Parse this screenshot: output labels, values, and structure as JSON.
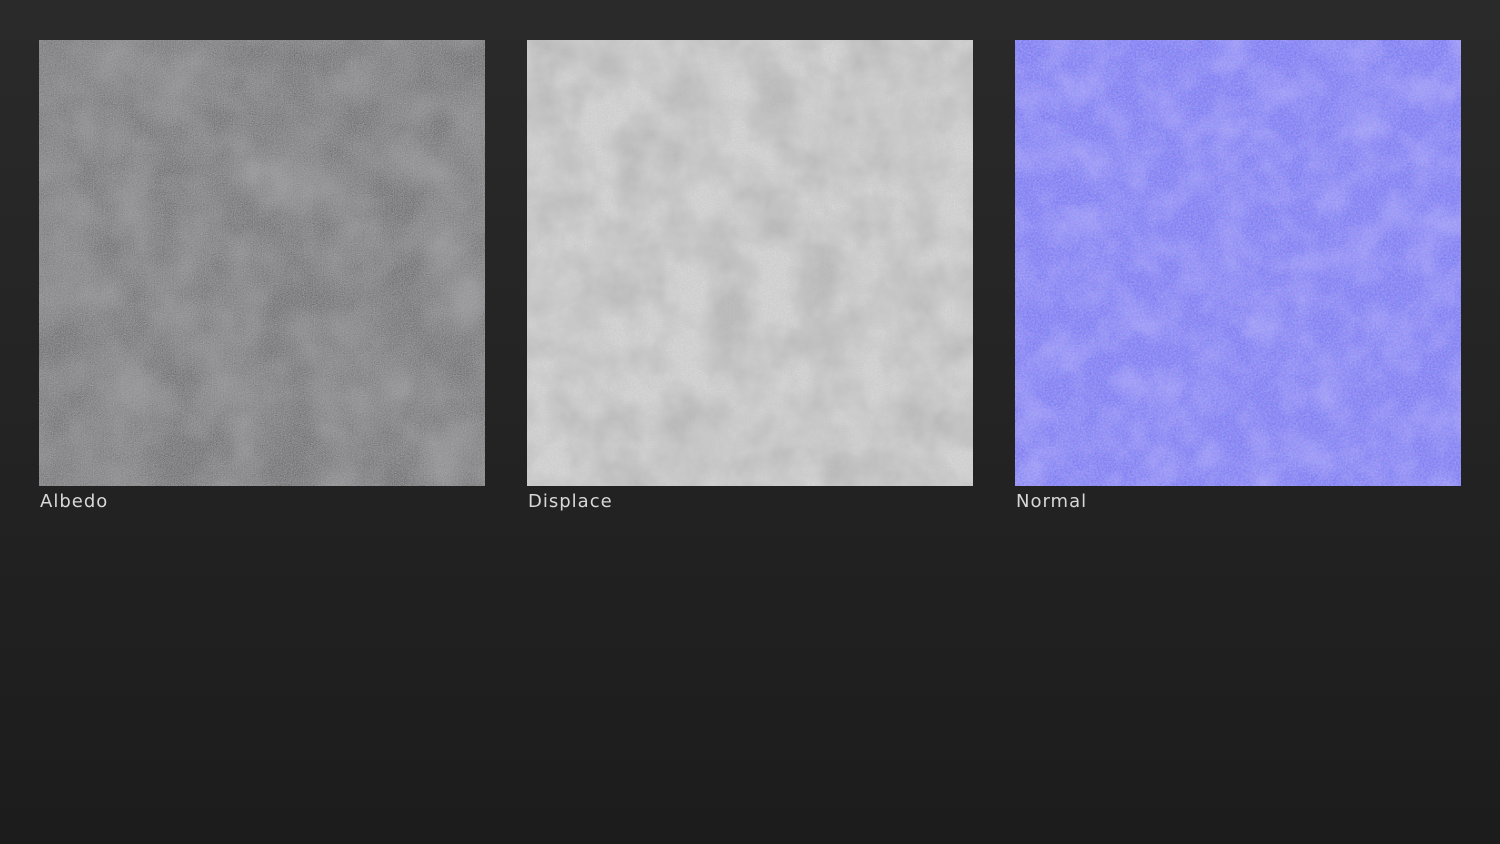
{
  "maps": [
    {
      "id": "albedo",
      "label": "Albedo",
      "base_color": "#5c5c5e"
    },
    {
      "id": "displace",
      "label": "Displace",
      "base_color": "#d6d6d6"
    },
    {
      "id": "normal",
      "label": "Normal",
      "base_color": "#7b7cf3"
    }
  ],
  "colors": {
    "background_top": "#2a2a2a",
    "background_bottom": "#1c1c1c",
    "label_text": "#d8d8d8"
  }
}
